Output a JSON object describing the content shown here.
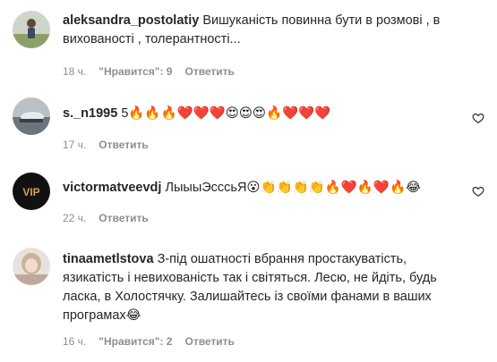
{
  "comments": [
    {
      "username": "aleksandra_postolatiy",
      "text": "Вишуканість повинна бути в розмові , в вихованості , толерантності...",
      "time": "18 ч.",
      "likes": "\"Нравится\": 9",
      "reply": "Ответить"
    },
    {
      "username": "s._n1995",
      "text": "5🔥🔥🔥❤️❤️❤️😍😍😍🔥❤️❤️❤️",
      "time": "17 ч.",
      "reply": "Ответить"
    },
    {
      "username": "victormatveevdj",
      "text": "ЛыыыЭсссьЯ😮👏👏👏👏🔥❤️🔥❤️🔥😂",
      "time": "22 ч.",
      "reply": "Ответить",
      "avatar_text": "VIP"
    },
    {
      "username": "tinaametlstova",
      "text": "З-під ошатності вбрання простакуватість, язикатість і невихованість так і світяться. Лесю, не йдіть, будь ласка, в Холостячку. Залишайтесь із своїми фанами в ваших програмах😂",
      "time": "16 ч.",
      "likes": "\"Нравится\": 2",
      "reply": "Ответить"
    }
  ],
  "colors": {
    "text": "#262626",
    "meta": "#8e8e8e",
    "background": "#ffffff"
  },
  "icons": {
    "like": "heart-outline-icon"
  }
}
